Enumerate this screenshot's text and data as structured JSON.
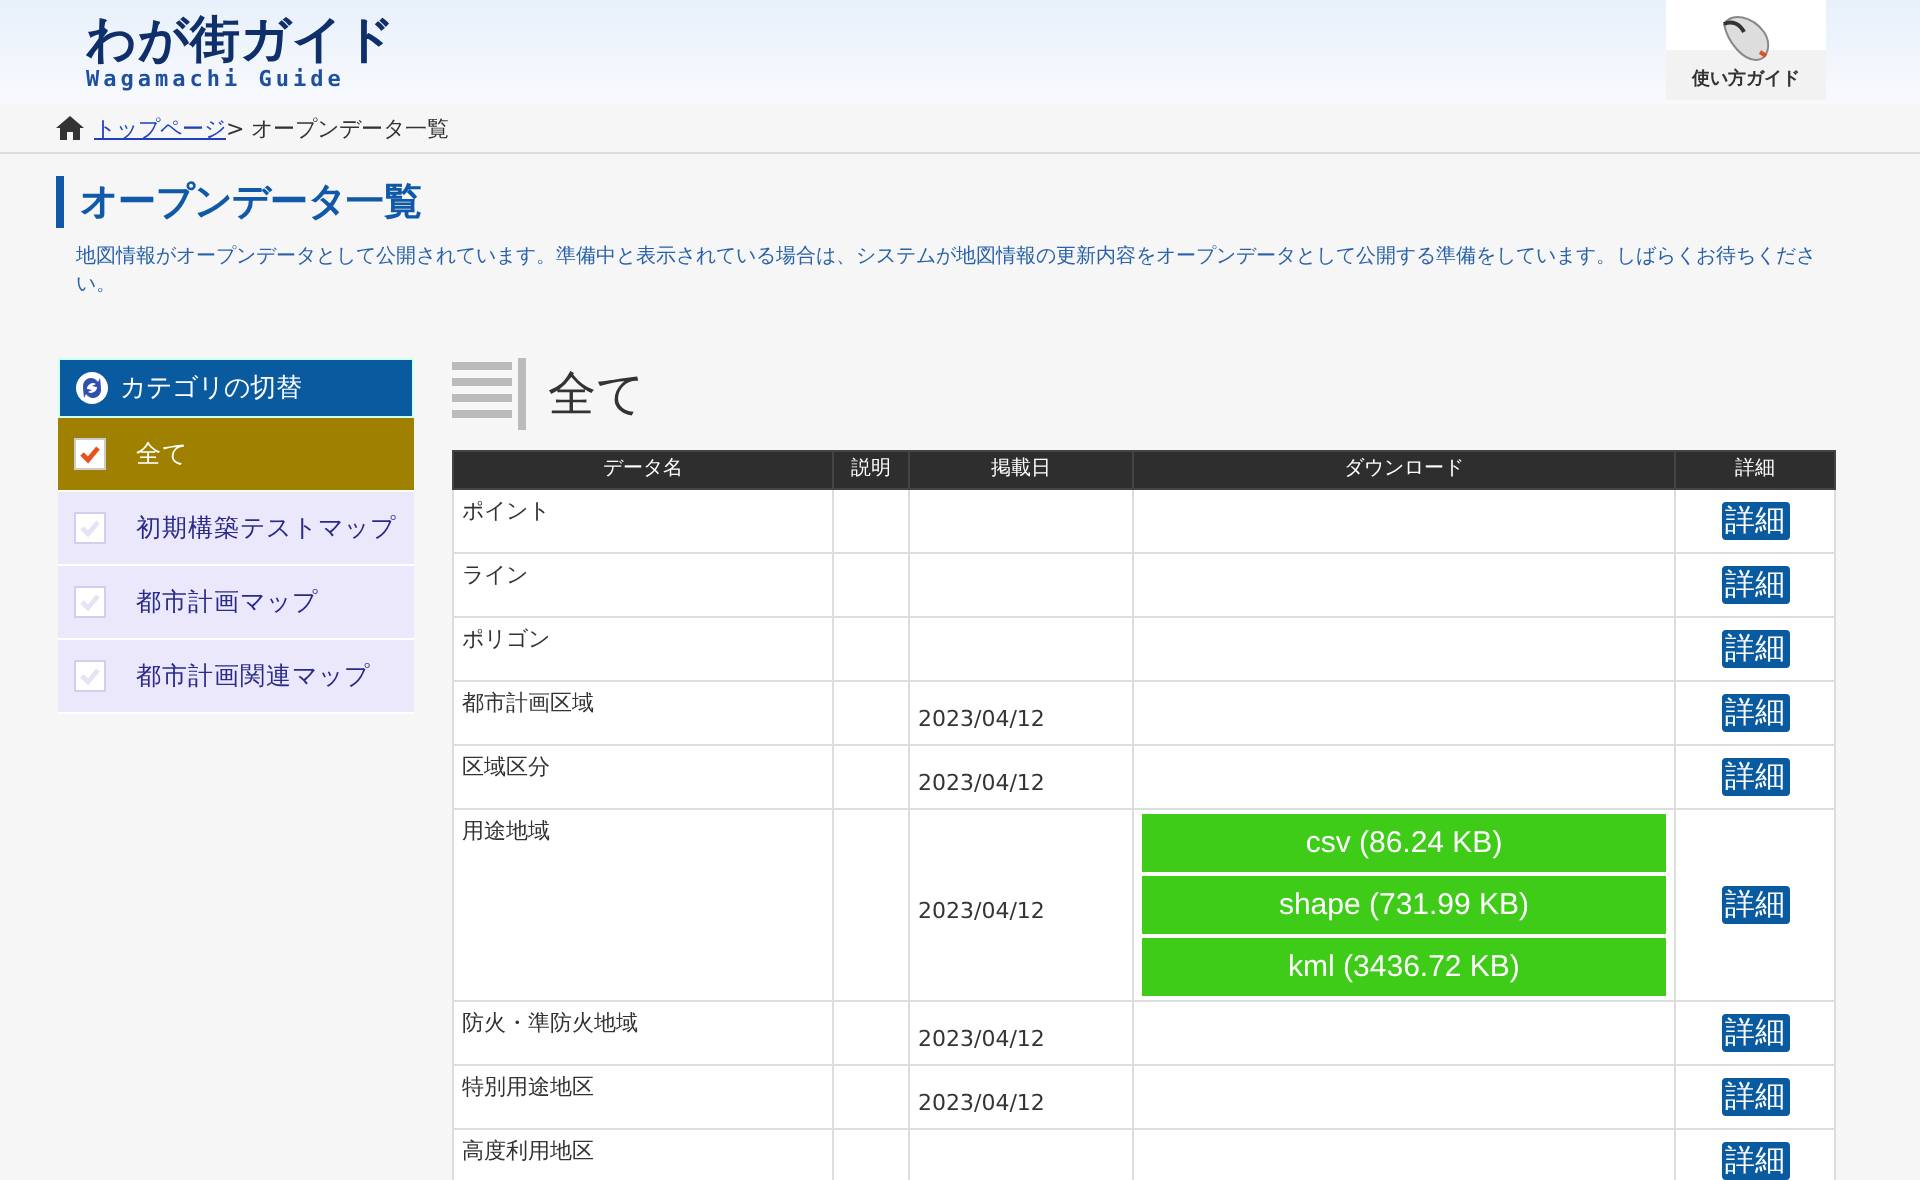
{
  "header": {
    "logo": {
      "title": "わが街ガイド",
      "subtitle": "Wagamachi Guide"
    },
    "guide_button": "使い方ガイド"
  },
  "breadcrumb": {
    "link": "トップページ",
    "current": "> オープンデータ一覧"
  },
  "page": {
    "title": "オープンデータ一覧",
    "description": "地図情報がオープンデータとして公開されています。準備中と表示されている場合は、システムが地図情報の更新内容をオープンデータとして公開する準備をしています。しばらくお待ちください。"
  },
  "sidebar": {
    "title": "カテゴリの切替",
    "items": [
      {
        "label": "全て",
        "selected": true
      },
      {
        "label": "初期構築テストマップ",
        "selected": false
      },
      {
        "label": "都市計画マップ",
        "selected": false
      },
      {
        "label": "都市計画関連マップ",
        "selected": false
      }
    ]
  },
  "section_title": "全て",
  "table": {
    "columns": [
      "データ名",
      "説明",
      "掲載日",
      "ダウンロード",
      "詳細"
    ],
    "rows": [
      {
        "name": "ポイント",
        "date": "",
        "downloads": [],
        "detail": "詳細"
      },
      {
        "name": "ライン",
        "date": "",
        "downloads": [],
        "detail": "詳細"
      },
      {
        "name": "ポリゴン",
        "date": "",
        "downloads": [],
        "detail": "詳細"
      },
      {
        "name": "都市計画区域",
        "date": "2023/04/12",
        "downloads": [],
        "detail": "詳細"
      },
      {
        "name": "区域区分",
        "date": "2023/04/12",
        "downloads": [],
        "detail": "詳細"
      },
      {
        "name": "用途地域",
        "date": "2023/04/12",
        "downloads": [
          "csv (86.24 KB)",
          "shape (731.99 KB)",
          "kml (3436.72 KB)"
        ],
        "detail": "詳細"
      },
      {
        "name": "防火・準防火地域",
        "date": "2023/04/12",
        "downloads": [],
        "detail": "詳細"
      },
      {
        "name": "特別用途地区",
        "date": "2023/04/12",
        "downloads": [],
        "detail": "詳細"
      },
      {
        "name": "高度利用地区",
        "date": "",
        "downloads": [],
        "detail": "詳細"
      }
    ]
  }
}
